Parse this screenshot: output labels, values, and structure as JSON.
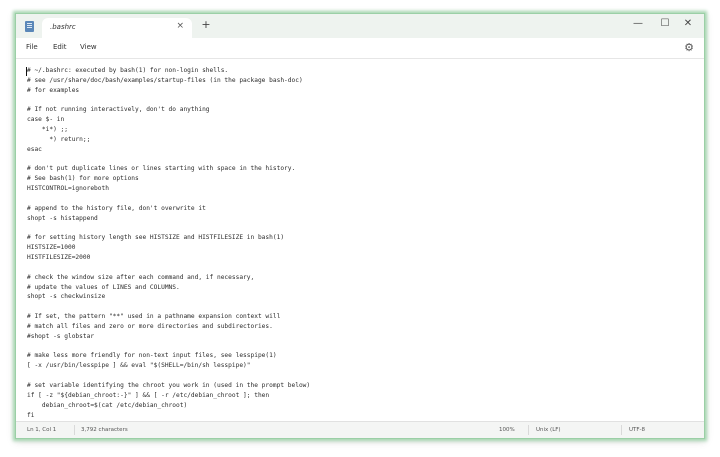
{
  "window": {
    "tab_title": ".bashrc",
    "tab_close": "×",
    "new_tab": "+",
    "controls": {
      "minimize": "—",
      "maximize": "☐",
      "close": "✕"
    }
  },
  "menu": {
    "items": [
      "File",
      "Edit",
      "View"
    ],
    "settings_icon": "⚙"
  },
  "editor": {
    "lines": [
      "# ~/.bashrc: executed by bash(1) for non-login shells.",
      "# see /usr/share/doc/bash/examples/startup-files (in the package bash-doc)",
      "# for examples",
      "",
      "# If not running interactively, don't do anything",
      "case $- in",
      "    *i*) ;;",
      "      *) return;;",
      "esac",
      "",
      "# don't put duplicate lines or lines starting with space in the history.",
      "# See bash(1) for more options",
      "HISTCONTROL=ignoreboth",
      "",
      "# append to the history file, don't overwrite it",
      "shopt -s histappend",
      "",
      "# for setting history length see HISTSIZE and HISTFILESIZE in bash(1)",
      "HISTSIZE=1000",
      "HISTFILESIZE=2000",
      "",
      "# check the window size after each command and, if necessary,",
      "# update the values of LINES and COLUMNS.",
      "shopt -s checkwinsize",
      "",
      "# If set, the pattern \"**\" used in a pathname expansion context will",
      "# match all files and zero or more directories and subdirectories.",
      "#shopt -s globstar",
      "",
      "# make less more friendly for non-text input files, see lesspipe(1)",
      "[ -x /usr/bin/lesspipe ] && eval \"$(SHELL=/bin/sh lesspipe)\"",
      "",
      "# set variable identifying the chroot you work in (used in the prompt below)",
      "if [ -z \"${debian_chroot:-}\" ] && [ -r /etc/debian_chroot ]; then",
      "    debian_chroot=$(cat /etc/debian_chroot)",
      "fi"
    ]
  },
  "status": {
    "position": "Ln 1, Col 1",
    "characters": "3,792 characters",
    "zoom": "100%",
    "line_ending": "Unix (LF)",
    "encoding": "UTF-8"
  }
}
